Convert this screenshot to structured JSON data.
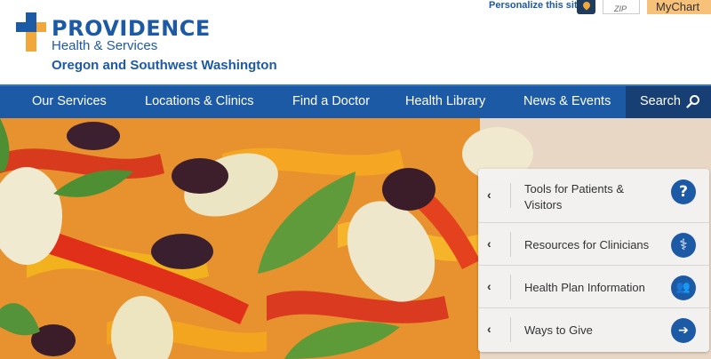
{
  "header": {
    "brand": "PROVIDENCE",
    "brand_sub": "Health & Services",
    "region": "Oregon and Southwest Washington",
    "personalize_label": "Personalize this site:",
    "zip_placeholder": "ZIP",
    "mychart_label": "MyChart"
  },
  "nav": {
    "items": [
      {
        "label": "Our Services"
      },
      {
        "label": "Locations & Clinics"
      },
      {
        "label": "Find a Doctor"
      },
      {
        "label": "Health Library"
      },
      {
        "label": "News & Events"
      }
    ],
    "search_label": "Search"
  },
  "panel": {
    "items": [
      {
        "label": "Tools for Patients & Visitors",
        "icon": "question-icon",
        "glyph": "?"
      },
      {
        "label": "Resources for Clinicians",
        "icon": "stethoscope-icon",
        "glyph": "⚕"
      },
      {
        "label": "Health Plan Information",
        "icon": "people-icon",
        "glyph": "👥"
      },
      {
        "label": "Ways to Give",
        "icon": "arrow-right-icon",
        "glyph": "➔"
      }
    ],
    "chevron": "‹"
  },
  "colors": {
    "brand_blue": "#1d5aa5",
    "nav_dark": "#183f73",
    "accent_orange": "#f1a73a",
    "mychart_bg": "#f7c17a"
  }
}
